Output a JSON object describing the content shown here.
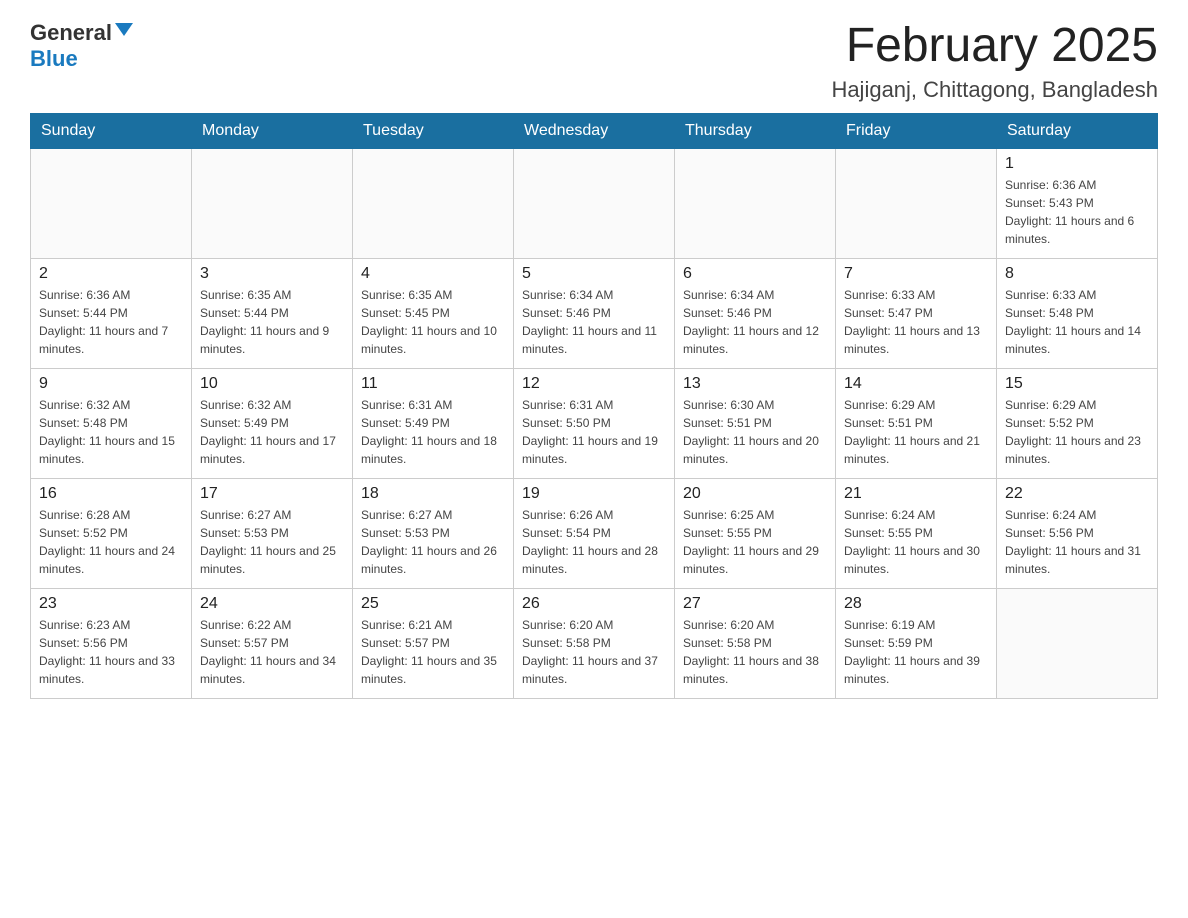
{
  "header": {
    "logo_general": "General",
    "logo_blue": "Blue",
    "month_title": "February 2025",
    "location": "Hajiganj, Chittagong, Bangladesh"
  },
  "days_of_week": [
    "Sunday",
    "Monday",
    "Tuesday",
    "Wednesday",
    "Thursday",
    "Friday",
    "Saturday"
  ],
  "weeks": [
    [
      {
        "day": "",
        "info": ""
      },
      {
        "day": "",
        "info": ""
      },
      {
        "day": "",
        "info": ""
      },
      {
        "day": "",
        "info": ""
      },
      {
        "day": "",
        "info": ""
      },
      {
        "day": "",
        "info": ""
      },
      {
        "day": "1",
        "info": "Sunrise: 6:36 AM\nSunset: 5:43 PM\nDaylight: 11 hours and 6 minutes."
      }
    ],
    [
      {
        "day": "2",
        "info": "Sunrise: 6:36 AM\nSunset: 5:44 PM\nDaylight: 11 hours and 7 minutes."
      },
      {
        "day": "3",
        "info": "Sunrise: 6:35 AM\nSunset: 5:44 PM\nDaylight: 11 hours and 9 minutes."
      },
      {
        "day": "4",
        "info": "Sunrise: 6:35 AM\nSunset: 5:45 PM\nDaylight: 11 hours and 10 minutes."
      },
      {
        "day": "5",
        "info": "Sunrise: 6:34 AM\nSunset: 5:46 PM\nDaylight: 11 hours and 11 minutes."
      },
      {
        "day": "6",
        "info": "Sunrise: 6:34 AM\nSunset: 5:46 PM\nDaylight: 11 hours and 12 minutes."
      },
      {
        "day": "7",
        "info": "Sunrise: 6:33 AM\nSunset: 5:47 PM\nDaylight: 11 hours and 13 minutes."
      },
      {
        "day": "8",
        "info": "Sunrise: 6:33 AM\nSunset: 5:48 PM\nDaylight: 11 hours and 14 minutes."
      }
    ],
    [
      {
        "day": "9",
        "info": "Sunrise: 6:32 AM\nSunset: 5:48 PM\nDaylight: 11 hours and 15 minutes."
      },
      {
        "day": "10",
        "info": "Sunrise: 6:32 AM\nSunset: 5:49 PM\nDaylight: 11 hours and 17 minutes."
      },
      {
        "day": "11",
        "info": "Sunrise: 6:31 AM\nSunset: 5:49 PM\nDaylight: 11 hours and 18 minutes."
      },
      {
        "day": "12",
        "info": "Sunrise: 6:31 AM\nSunset: 5:50 PM\nDaylight: 11 hours and 19 minutes."
      },
      {
        "day": "13",
        "info": "Sunrise: 6:30 AM\nSunset: 5:51 PM\nDaylight: 11 hours and 20 minutes."
      },
      {
        "day": "14",
        "info": "Sunrise: 6:29 AM\nSunset: 5:51 PM\nDaylight: 11 hours and 21 minutes."
      },
      {
        "day": "15",
        "info": "Sunrise: 6:29 AM\nSunset: 5:52 PM\nDaylight: 11 hours and 23 minutes."
      }
    ],
    [
      {
        "day": "16",
        "info": "Sunrise: 6:28 AM\nSunset: 5:52 PM\nDaylight: 11 hours and 24 minutes."
      },
      {
        "day": "17",
        "info": "Sunrise: 6:27 AM\nSunset: 5:53 PM\nDaylight: 11 hours and 25 minutes."
      },
      {
        "day": "18",
        "info": "Sunrise: 6:27 AM\nSunset: 5:53 PM\nDaylight: 11 hours and 26 minutes."
      },
      {
        "day": "19",
        "info": "Sunrise: 6:26 AM\nSunset: 5:54 PM\nDaylight: 11 hours and 28 minutes."
      },
      {
        "day": "20",
        "info": "Sunrise: 6:25 AM\nSunset: 5:55 PM\nDaylight: 11 hours and 29 minutes."
      },
      {
        "day": "21",
        "info": "Sunrise: 6:24 AM\nSunset: 5:55 PM\nDaylight: 11 hours and 30 minutes."
      },
      {
        "day": "22",
        "info": "Sunrise: 6:24 AM\nSunset: 5:56 PM\nDaylight: 11 hours and 31 minutes."
      }
    ],
    [
      {
        "day": "23",
        "info": "Sunrise: 6:23 AM\nSunset: 5:56 PM\nDaylight: 11 hours and 33 minutes."
      },
      {
        "day": "24",
        "info": "Sunrise: 6:22 AM\nSunset: 5:57 PM\nDaylight: 11 hours and 34 minutes."
      },
      {
        "day": "25",
        "info": "Sunrise: 6:21 AM\nSunset: 5:57 PM\nDaylight: 11 hours and 35 minutes."
      },
      {
        "day": "26",
        "info": "Sunrise: 6:20 AM\nSunset: 5:58 PM\nDaylight: 11 hours and 37 minutes."
      },
      {
        "day": "27",
        "info": "Sunrise: 6:20 AM\nSunset: 5:58 PM\nDaylight: 11 hours and 38 minutes."
      },
      {
        "day": "28",
        "info": "Sunrise: 6:19 AM\nSunset: 5:59 PM\nDaylight: 11 hours and 39 minutes."
      },
      {
        "day": "",
        "info": ""
      }
    ]
  ]
}
